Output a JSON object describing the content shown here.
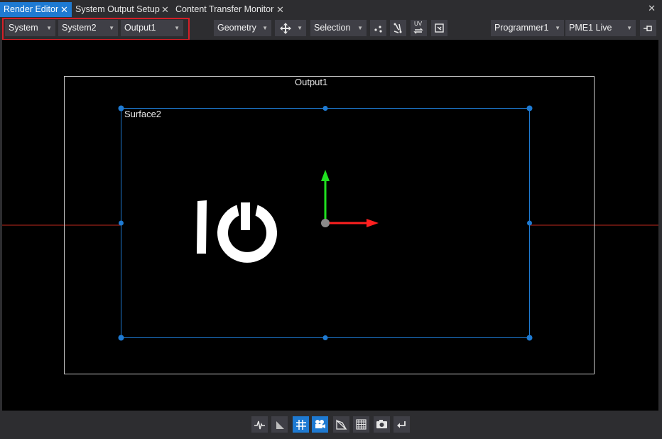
{
  "tabs": [
    {
      "label": "Render Editor",
      "close": "✕",
      "active": true
    },
    {
      "label": "System Output Setup",
      "close": "✕",
      "active": false
    },
    {
      "label": "Content Transfer Monitor",
      "close": "✕",
      "active": false
    }
  ],
  "window_close": "✕",
  "toolbar": {
    "system_select": "System",
    "system2_select": "System2",
    "output_select": "Output1",
    "geometry_select": "Geometry",
    "selection_select": "Selection",
    "programmer_select": "Programmer1",
    "pme_select": "PME1 Live",
    "uv_label": "UV"
  },
  "viewport": {
    "output_label": "Output1",
    "surface_label": "Surface2"
  },
  "colors": {
    "accent": "#1e7ad2",
    "highlight_border": "#d42027",
    "surface_outline": "#1e7ad2",
    "axis_x": "#ff2020",
    "axis_y": "#20e020",
    "center_line": "#c0281e"
  },
  "bottom_icons": [
    "waveform-icon",
    "gradient-icon",
    "grid-icon",
    "camera-film-icon",
    "perspective-icon",
    "grid-dots-icon",
    "snapshot-icon",
    "undo-icon"
  ]
}
